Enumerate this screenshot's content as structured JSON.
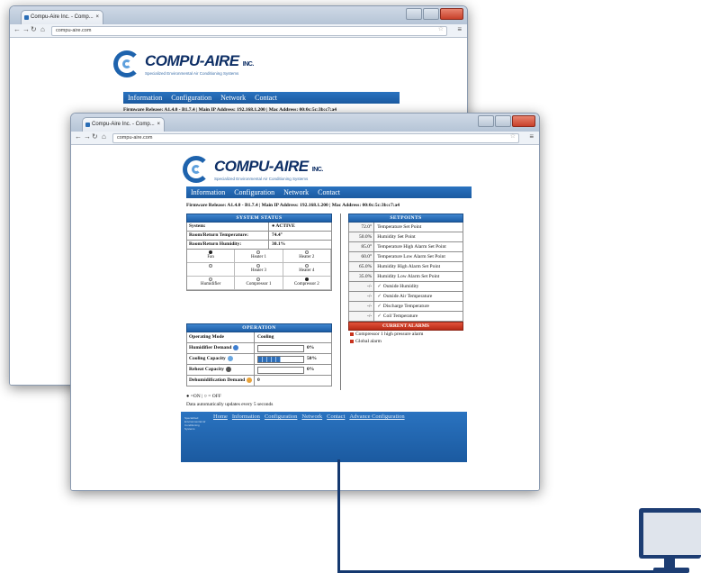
{
  "back_browser": {
    "tab_title": "Compu-Aire Inc. - Comp...",
    "url": "compu-aire.com",
    "logo_name": "COMPU-AIRE",
    "logo_inc": "INC.",
    "logo_tagline": "Specialized Environmental Air Conditioning Systems",
    "nav": [
      "Information",
      "Configuration",
      "Network",
      "Contact"
    ],
    "firmware_line": "Firmware Release: A1.4.0 - B1.7.4 | Main IP Address: 192.168.1.200 | Mac Address: 00:0c:5c:3b:c7:a4"
  },
  "front_browser": {
    "tab_title": "Compu-Aire Inc. - Comp...",
    "url": "compu-aire.com",
    "logo_name": "COMPU-AIRE",
    "logo_inc": "INC.",
    "logo_tagline": "Specialized Environmental Air Conditioning Systems",
    "nav": [
      "Information",
      "Configuration",
      "Network",
      "Contact"
    ],
    "firmware_line": "Firmware Release: A1.4.0 - B1.7.4 | Main IP Address: 192.168.1.200 | Mac Address: 00:0c:5c:3b:c7:a4",
    "system_status": {
      "title": "SYSTEM STATUS",
      "rows": [
        {
          "label": "System:",
          "value": "● ACTIVE"
        },
        {
          "label": "Room/Return Temperature:",
          "value": "74.4°"
        },
        {
          "label": "Room/Return Humidity:",
          "value": "30.1%"
        }
      ],
      "components": [
        {
          "label": "Fan",
          "on": true
        },
        {
          "label": "Heater 1",
          "on": false
        },
        {
          "label": "Heater 2",
          "on": false
        },
        {
          "label": "",
          "on": false
        },
        {
          "label": "Heater 3",
          "on": false
        },
        {
          "label": "Heater 4",
          "on": false
        },
        {
          "label": "Humidifier",
          "on": false
        },
        {
          "label": "Compressor 1",
          "on": false
        },
        {
          "label": "Compressor 2",
          "on": true
        }
      ]
    },
    "operation": {
      "title": "OPERATION",
      "rows": [
        {
          "label": "Operating Mode",
          "value": "Cooling",
          "bar": null,
          "pct": ""
        },
        {
          "label": "Humidifier Demand",
          "value": "",
          "bar": 0,
          "pct": "0%"
        },
        {
          "label": "Cooling Capacity",
          "value": "",
          "bar": 0.5,
          "pct": "50%"
        },
        {
          "label": "Reheat Capacity",
          "value": "",
          "bar": 0,
          "pct": "0%"
        },
        {
          "label": "Dehumidification Demand",
          "value": "0",
          "bar": null,
          "pct": ""
        }
      ]
    },
    "legend": "● =ON | ○ = OFF",
    "auto_update": "Data automatically updates every 5 seconds",
    "setpoints": {
      "title": "SETPOINTS",
      "rows": [
        {
          "value": "72.0°",
          "name": "Temperature Set Point"
        },
        {
          "value": "50.0%",
          "name": "Humidity Set Point"
        },
        {
          "value": "85.0°",
          "name": "Temperature High Alarm Set Point"
        },
        {
          "value": "60.0°",
          "name": "Temperature Low Alarm Set Point"
        },
        {
          "value": "65.0%",
          "name": "Humidity High Alarm Set Point"
        },
        {
          "value": "35.0%",
          "name": "Humidity Low Alarm Set Point"
        },
        {
          "value": "-/-",
          "name": "Outside Humidity"
        },
        {
          "value": "-/-",
          "name": "Outside Air Temperature"
        },
        {
          "value": "-/-",
          "name": "Discharge Temperature"
        },
        {
          "value": "-/-",
          "name": "Coil Temperature"
        }
      ]
    },
    "alarms": {
      "title": "CURRENT ALARMS",
      "items": [
        "Compressor 1 high pressure alarm",
        "Global alarm"
      ]
    },
    "footer_links": [
      "Home",
      "Information",
      "Configuration",
      "Network",
      "Contact",
      "Advance Configuration"
    ],
    "footer_small": "Specialized Environmental Air Conditioning Systems"
  },
  "colors": {
    "nav_blue": "#1e63ad",
    "cable_blue": "#14386f",
    "alarm_red": "#c8341f"
  }
}
